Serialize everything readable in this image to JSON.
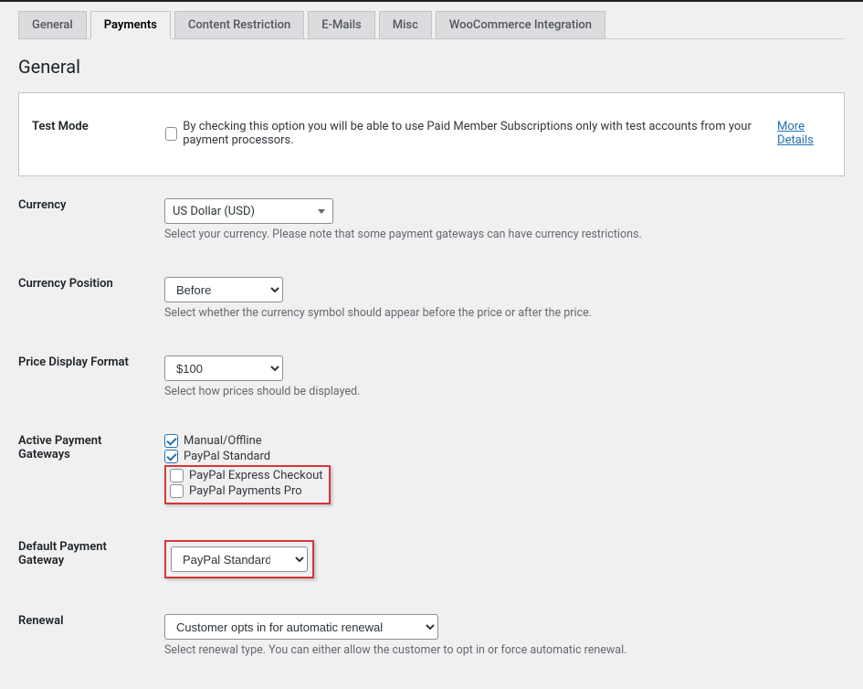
{
  "tabs": {
    "general": "General",
    "payments": "Payments",
    "content": "Content Restriction",
    "emails": "E-Mails",
    "misc": "Misc",
    "woo": "WooCommerce Integration"
  },
  "section_title": "General",
  "test_mode": {
    "label": "Test Mode",
    "description": "By checking this option you will be able to use Paid Member Subscriptions only with test accounts from your payment processors.",
    "link_text": "More Details"
  },
  "currency": {
    "label": "Currency",
    "value": "US Dollar (USD)",
    "description": "Select your currency. Please note that some payment gateways can have currency restrictions."
  },
  "currency_position": {
    "label": "Currency Position",
    "value": "Before",
    "description": "Select whether the currency symbol should appear before the price or after the price."
  },
  "price_display": {
    "label": "Price Display Format",
    "value": "$100",
    "description": "Select how prices should be displayed."
  },
  "gateways": {
    "label": "Active Payment Gateways",
    "manual": "Manual/Offline",
    "paypal_std": "PayPal Standard",
    "paypal_express": "PayPal Express Checkout",
    "paypal_pro": "PayPal Payments Pro"
  },
  "default_gateway": {
    "label": "Default Payment Gateway",
    "value": "PayPal Standard"
  },
  "renewal": {
    "label": "Renewal",
    "value": "Customer opts in for automatic renewal",
    "description": "Select renewal type. You can either allow the customer to opt in or force automatic renewal."
  }
}
